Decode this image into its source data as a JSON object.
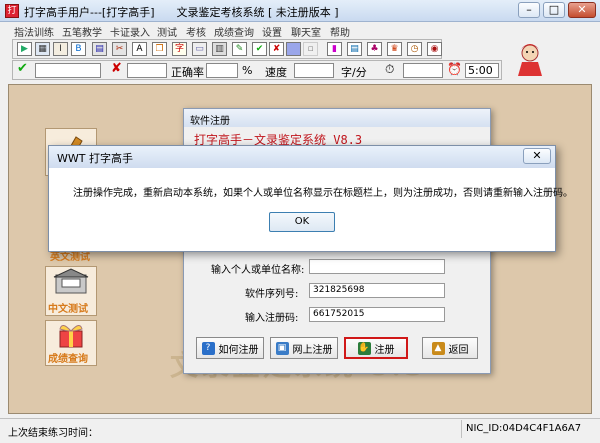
{
  "window": {
    "title": "打字高手用户---[打字高手]　　文录鉴定考核系统 [ 未注册版本 ]",
    "minimize": "–",
    "maximize": "□",
    "close": "✕"
  },
  "menu": [
    "指法训练",
    "五笔教学",
    "卡证录入",
    "测试",
    "考核",
    "成绩查询",
    "设置",
    "聊天室",
    "帮助"
  ],
  "toolbar2": {
    "accuracy_label": "正确率",
    "percent": "%",
    "speed_label": "速度",
    "speed_unit": "字/分",
    "timer": "5:00"
  },
  "sidebar": {
    "chinese_test": "中文测试",
    "score_query": "成绩查询",
    "partial_label": "英文测试"
  },
  "background_title": "文录鉴定系统 8.3",
  "reg_dialog": {
    "title": "软件注册",
    "banner": "打字高手－文录鉴定系统 V8.3",
    "name_label": "输入个人或单位名称:",
    "name_value": "",
    "serial_label": "软件序列号:",
    "serial_value": "321825698",
    "code_label": "输入注册码:",
    "code_value": "661752015",
    "btn_how": "如何注册",
    "btn_online": "网上注册",
    "btn_register": "注册",
    "btn_back": "返回"
  },
  "msgbox": {
    "title": "WWT 打字高手",
    "message": "注册操作完成，重新启动本系统，如果个人或单位名称显示在标题栏上，则为注册成功，否则请重新输入注册码。",
    "ok": "OK",
    "close": "✕"
  },
  "status": {
    "last_practice": "上次结束练习时间：",
    "nic": "NIC_ID:04D4C4F1A6A7"
  }
}
